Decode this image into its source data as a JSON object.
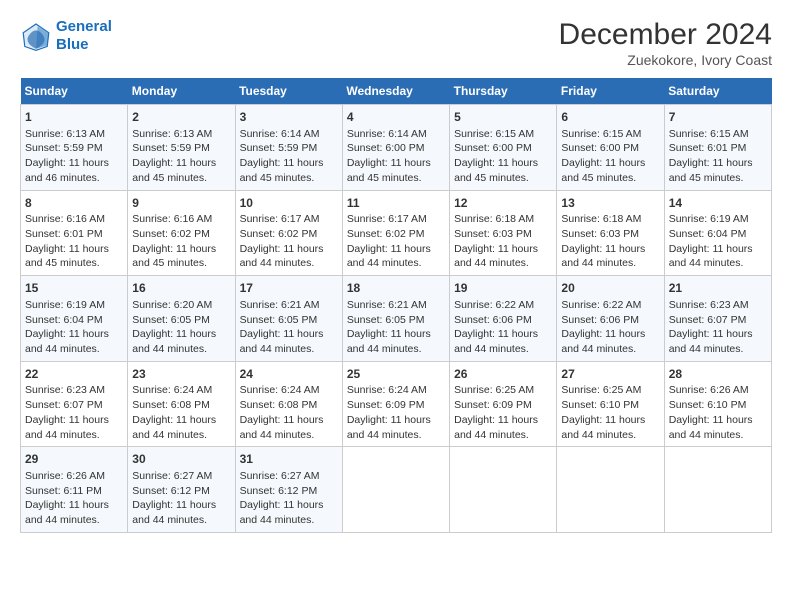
{
  "logo": {
    "line1": "General",
    "line2": "Blue"
  },
  "title": "December 2024",
  "subtitle": "Zuekokore, Ivory Coast",
  "days_header": [
    "Sunday",
    "Monday",
    "Tuesday",
    "Wednesday",
    "Thursday",
    "Friday",
    "Saturday"
  ],
  "weeks": [
    [
      {
        "day": "1",
        "info": "Sunrise: 6:13 AM\nSunset: 5:59 PM\nDaylight: 11 hours\nand 46 minutes."
      },
      {
        "day": "2",
        "info": "Sunrise: 6:13 AM\nSunset: 5:59 PM\nDaylight: 11 hours\nand 45 minutes."
      },
      {
        "day": "3",
        "info": "Sunrise: 6:14 AM\nSunset: 5:59 PM\nDaylight: 11 hours\nand 45 minutes."
      },
      {
        "day": "4",
        "info": "Sunrise: 6:14 AM\nSunset: 6:00 PM\nDaylight: 11 hours\nand 45 minutes."
      },
      {
        "day": "5",
        "info": "Sunrise: 6:15 AM\nSunset: 6:00 PM\nDaylight: 11 hours\nand 45 minutes."
      },
      {
        "day": "6",
        "info": "Sunrise: 6:15 AM\nSunset: 6:00 PM\nDaylight: 11 hours\nand 45 minutes."
      },
      {
        "day": "7",
        "info": "Sunrise: 6:15 AM\nSunset: 6:01 PM\nDaylight: 11 hours\nand 45 minutes."
      }
    ],
    [
      {
        "day": "8",
        "info": "Sunrise: 6:16 AM\nSunset: 6:01 PM\nDaylight: 11 hours\nand 45 minutes."
      },
      {
        "day": "9",
        "info": "Sunrise: 6:16 AM\nSunset: 6:02 PM\nDaylight: 11 hours\nand 45 minutes."
      },
      {
        "day": "10",
        "info": "Sunrise: 6:17 AM\nSunset: 6:02 PM\nDaylight: 11 hours\nand 44 minutes."
      },
      {
        "day": "11",
        "info": "Sunrise: 6:17 AM\nSunset: 6:02 PM\nDaylight: 11 hours\nand 44 minutes."
      },
      {
        "day": "12",
        "info": "Sunrise: 6:18 AM\nSunset: 6:03 PM\nDaylight: 11 hours\nand 44 minutes."
      },
      {
        "day": "13",
        "info": "Sunrise: 6:18 AM\nSunset: 6:03 PM\nDaylight: 11 hours\nand 44 minutes."
      },
      {
        "day": "14",
        "info": "Sunrise: 6:19 AM\nSunset: 6:04 PM\nDaylight: 11 hours\nand 44 minutes."
      }
    ],
    [
      {
        "day": "15",
        "info": "Sunrise: 6:19 AM\nSunset: 6:04 PM\nDaylight: 11 hours\nand 44 minutes."
      },
      {
        "day": "16",
        "info": "Sunrise: 6:20 AM\nSunset: 6:05 PM\nDaylight: 11 hours\nand 44 minutes."
      },
      {
        "day": "17",
        "info": "Sunrise: 6:21 AM\nSunset: 6:05 PM\nDaylight: 11 hours\nand 44 minutes."
      },
      {
        "day": "18",
        "info": "Sunrise: 6:21 AM\nSunset: 6:05 PM\nDaylight: 11 hours\nand 44 minutes."
      },
      {
        "day": "19",
        "info": "Sunrise: 6:22 AM\nSunset: 6:06 PM\nDaylight: 11 hours\nand 44 minutes."
      },
      {
        "day": "20",
        "info": "Sunrise: 6:22 AM\nSunset: 6:06 PM\nDaylight: 11 hours\nand 44 minutes."
      },
      {
        "day": "21",
        "info": "Sunrise: 6:23 AM\nSunset: 6:07 PM\nDaylight: 11 hours\nand 44 minutes."
      }
    ],
    [
      {
        "day": "22",
        "info": "Sunrise: 6:23 AM\nSunset: 6:07 PM\nDaylight: 11 hours\nand 44 minutes."
      },
      {
        "day": "23",
        "info": "Sunrise: 6:24 AM\nSunset: 6:08 PM\nDaylight: 11 hours\nand 44 minutes."
      },
      {
        "day": "24",
        "info": "Sunrise: 6:24 AM\nSunset: 6:08 PM\nDaylight: 11 hours\nand 44 minutes."
      },
      {
        "day": "25",
        "info": "Sunrise: 6:24 AM\nSunset: 6:09 PM\nDaylight: 11 hours\nand 44 minutes."
      },
      {
        "day": "26",
        "info": "Sunrise: 6:25 AM\nSunset: 6:09 PM\nDaylight: 11 hours\nand 44 minutes."
      },
      {
        "day": "27",
        "info": "Sunrise: 6:25 AM\nSunset: 6:10 PM\nDaylight: 11 hours\nand 44 minutes."
      },
      {
        "day": "28",
        "info": "Sunrise: 6:26 AM\nSunset: 6:10 PM\nDaylight: 11 hours\nand 44 minutes."
      }
    ],
    [
      {
        "day": "29",
        "info": "Sunrise: 6:26 AM\nSunset: 6:11 PM\nDaylight: 11 hours\nand 44 minutes."
      },
      {
        "day": "30",
        "info": "Sunrise: 6:27 AM\nSunset: 6:12 PM\nDaylight: 11 hours\nand 44 minutes."
      },
      {
        "day": "31",
        "info": "Sunrise: 6:27 AM\nSunset: 6:12 PM\nDaylight: 11 hours\nand 44 minutes."
      },
      null,
      null,
      null,
      null
    ]
  ]
}
